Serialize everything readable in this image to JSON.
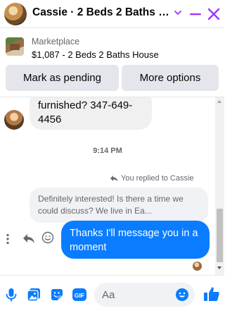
{
  "header": {
    "title": "Cassie · 2 Beds 2 Baths House",
    "chevron_icon": "chevron-down-icon",
    "minimize_icon": "minimize-icon",
    "close_icon": "close-icon",
    "accent_color": "#a033ff"
  },
  "marketplace": {
    "label": "Marketplace",
    "item": "$1,087 - 2 Beds 2 Baths House",
    "pending_button": "Mark as pending",
    "more_button": "More options"
  },
  "thread": {
    "incoming_message": "furnished? 347-649-4456",
    "timestamp": "9:14 PM",
    "replied_text": "You replied to Cassie",
    "quoted_message": "Definitely interested!  Is there a time we could discuss?  We live in Ea...",
    "outgoing_message": "Thanks I'll message you in a moment",
    "outgoing_color": "#0a7cff"
  },
  "composer": {
    "placeholder": "Aa",
    "icons": [
      "microphone-icon",
      "photo-icon",
      "sticker-icon",
      "gif-icon",
      "emoji-icon",
      "thumbs-up-icon"
    ],
    "accent_color": "#0a7cff"
  }
}
